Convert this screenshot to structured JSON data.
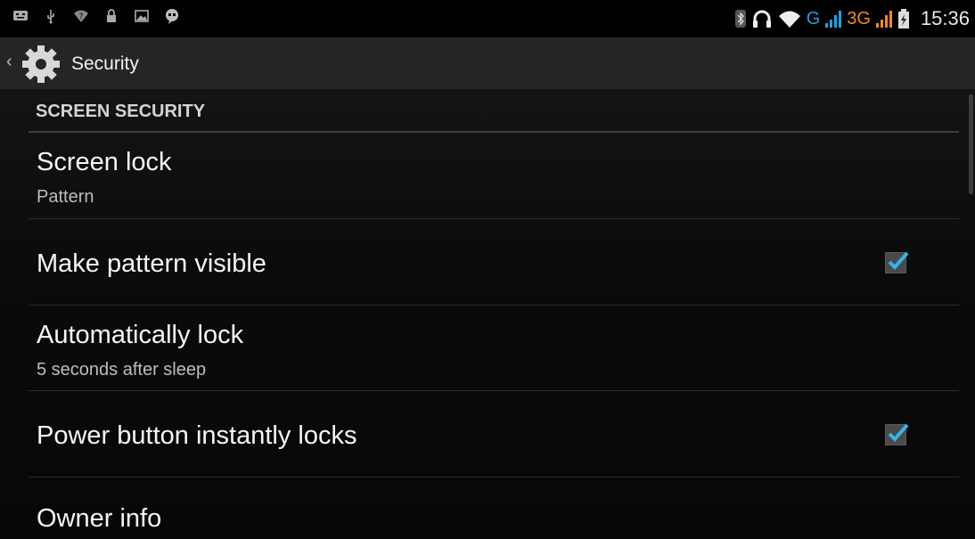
{
  "status_bar": {
    "time": "15:36",
    "network_g": "G",
    "network_3g": "3G",
    "left_icons": [
      "bbm-icon",
      "usb-icon",
      "wifi-question-icon",
      "lock-icon",
      "image-icon",
      "chat-icon"
    ],
    "right_icons": [
      "bluetooth-icon",
      "headset-icon",
      "wifi-icon",
      "signal-icon",
      "battery-icon"
    ]
  },
  "action_bar": {
    "title": "Security",
    "icon": "gear-icon"
  },
  "section": {
    "header": "SCREEN SECURITY"
  },
  "items": [
    {
      "title": "Screen lock",
      "subtitle": "Pattern"
    },
    {
      "title": "Make pattern visible",
      "checked": true
    },
    {
      "title": "Automatically lock",
      "subtitle": "5 seconds after sleep"
    },
    {
      "title": "Power button instantly locks",
      "checked": true
    },
    {
      "title": "Owner info"
    }
  ],
  "colors": {
    "accent": "#33b5e5",
    "network_g": "#1ea0e0",
    "network_3g": "#f08a24"
  }
}
